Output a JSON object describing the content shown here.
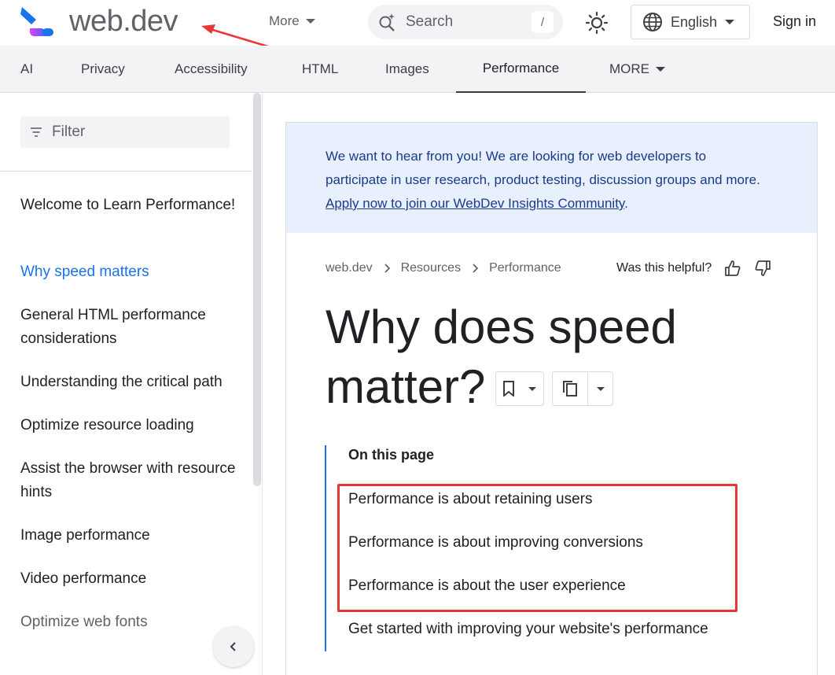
{
  "header": {
    "brand": "web.dev",
    "more_label": "More",
    "search_placeholder": "Search",
    "search_shortcut": "/",
    "language": "English",
    "signin_label": "Sign in"
  },
  "tabs": [
    {
      "label": "AI"
    },
    {
      "label": "Privacy"
    },
    {
      "label": "Accessibility"
    },
    {
      "label": "HTML"
    },
    {
      "label": "Images"
    },
    {
      "label": "Performance",
      "active": true
    },
    {
      "label": "MORE"
    }
  ],
  "sidebar": {
    "filter_placeholder": "Filter",
    "items": [
      {
        "label": "Welcome to Learn Performance!"
      },
      {
        "label": "Why speed matters",
        "active": true
      },
      {
        "label": "General HTML performance considerations"
      },
      {
        "label": "Understanding the critical path"
      },
      {
        "label": "Optimize resource loading"
      },
      {
        "label": "Assist the browser with resource hints"
      },
      {
        "label": "Image performance"
      },
      {
        "label": "Video performance"
      },
      {
        "label": "Optimize web fonts"
      }
    ]
  },
  "banner": {
    "line1": "We want to hear from you! We are looking for web developers to",
    "line2": "participate in user research, product testing, discussion groups and more.",
    "link": "Apply now to join our WebDev Insights Community",
    "link_suffix": "."
  },
  "breadcrumb": [
    "web.dev",
    "Resources",
    "Performance"
  ],
  "helpful_label": "Was this helpful?",
  "page_title": "Why does speed matter?",
  "toc": {
    "title": "On this page",
    "items": [
      "Performance is about retaining users",
      "Performance is about improving conversions",
      "Performance is about the user experience",
      "Get started with improving your website's performance"
    ]
  },
  "colors": {
    "accent": "#1a73e8",
    "highlight": "#e53935",
    "banner_bg": "#e8f0fe"
  }
}
